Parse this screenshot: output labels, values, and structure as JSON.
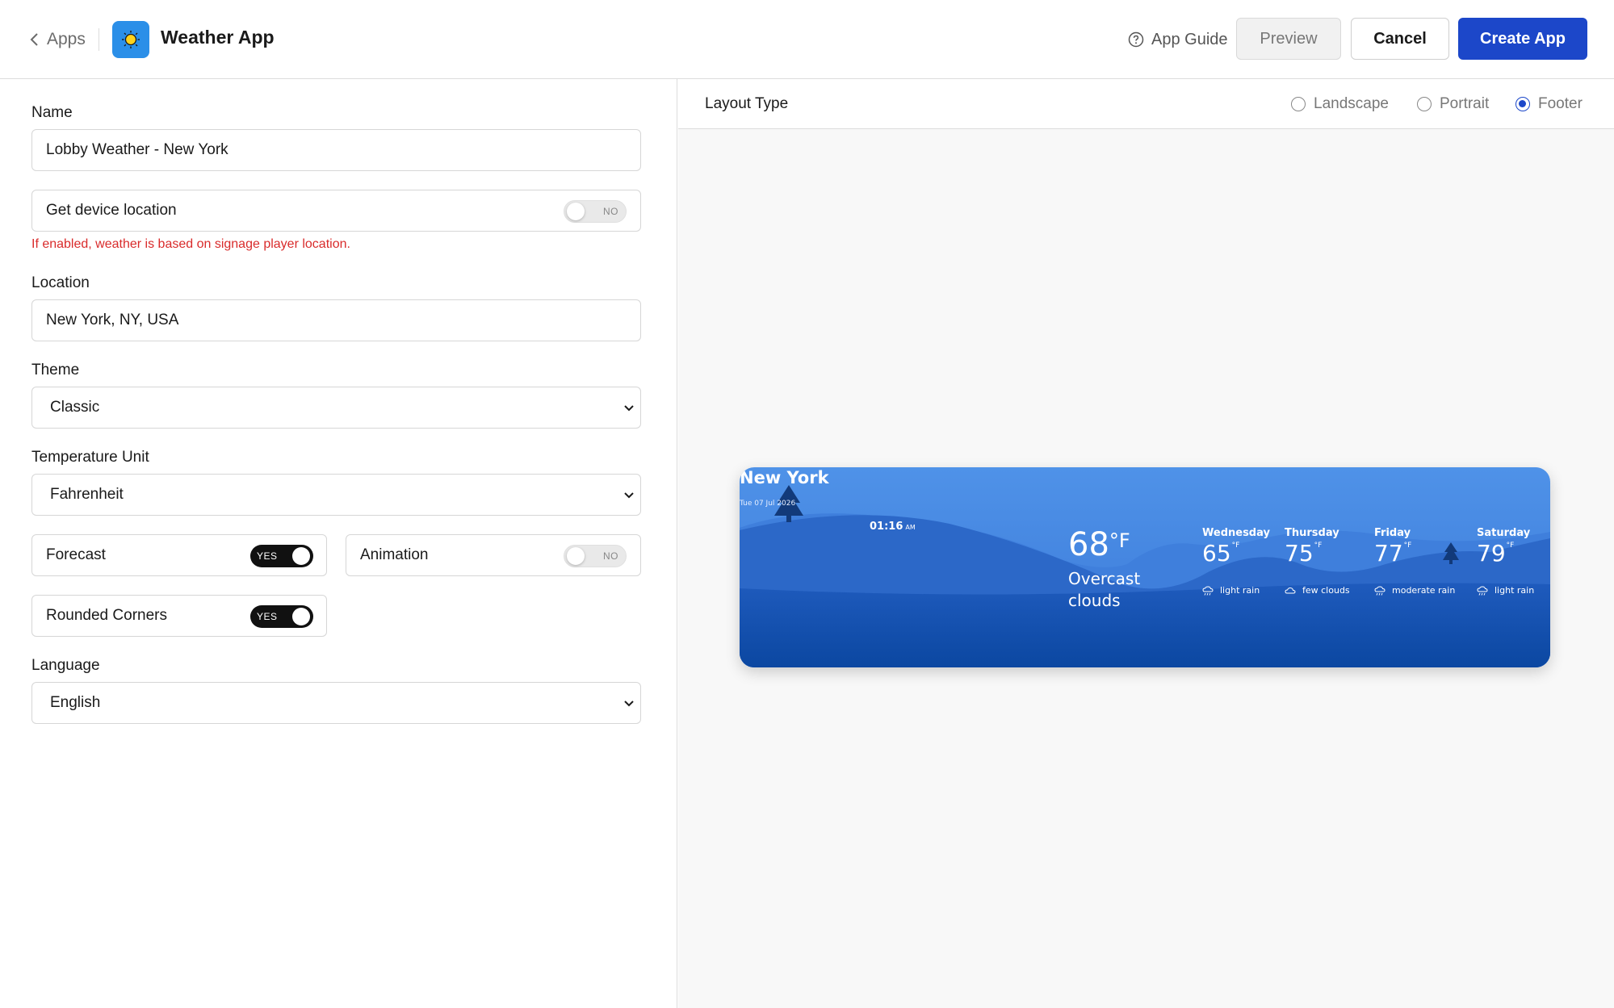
{
  "header": {
    "back_label": "Apps",
    "title": "Weather App",
    "guide_label": "App Guide",
    "preview_label": "Preview",
    "cancel_label": "Cancel",
    "create_label": "Create App",
    "accent": "#1c47c9"
  },
  "form": {
    "name": {
      "label": "Name",
      "value": "Lobby Weather - New York"
    },
    "device_location": {
      "label": "Get device location",
      "state": "NO",
      "hint": "If enabled, weather is based on signage player location.",
      "hint_color": "#d92b2b"
    },
    "location": {
      "label": "Location",
      "value": "New York, NY, USA"
    },
    "theme": {
      "label": "Theme",
      "value": "Classic"
    },
    "temperature_unit": {
      "label": "Temperature Unit",
      "value": "Fahrenheit"
    },
    "forecast": {
      "label": "Forecast",
      "state": "YES"
    },
    "animation": {
      "label": "Animation",
      "state": "NO"
    },
    "rounded_corners": {
      "label": "Rounded Corners",
      "state": "YES"
    },
    "language": {
      "label": "Language",
      "value": "English"
    }
  },
  "layout": {
    "title": "Layout Type",
    "options": [
      {
        "label": "Landscape",
        "selected": false
      },
      {
        "label": "Portrait",
        "selected": false
      },
      {
        "label": "Footer",
        "selected": true
      }
    ]
  },
  "widget": {
    "city": "New York",
    "date": "Tue 07 Jul 2026",
    "time": "01:16",
    "ampm": "AM",
    "temperature": "68",
    "unit": "°F",
    "condition_line1": "Overcast",
    "condition_line2": "clouds",
    "forecast": [
      {
        "day": "Wednesday",
        "temp": "65",
        "unit": "°F",
        "desc": "light rain",
        "icon": "rain-icon"
      },
      {
        "day": "Thursday",
        "temp": "75",
        "unit": "°F",
        "desc": "few clouds",
        "icon": "cloud-icon"
      },
      {
        "day": "Friday",
        "temp": "77",
        "unit": "°F",
        "desc": "moderate rain",
        "icon": "rain-icon"
      },
      {
        "day": "Saturday",
        "temp": "79",
        "unit": "°F",
        "desc": "light rain",
        "icon": "rain-icon"
      }
    ],
    "colors": {
      "sky": "#4f92e8",
      "hill": "#2a67c9",
      "ground": "#0d4aa3"
    }
  }
}
